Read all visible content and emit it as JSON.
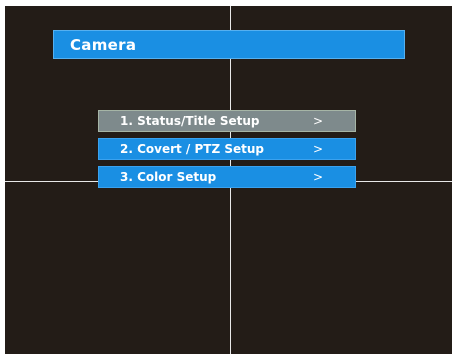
{
  "header": {
    "title": "Camera"
  },
  "menu": {
    "items": [
      {
        "label": "1. Status/Title Setup",
        "arrow": ">",
        "selected": true
      },
      {
        "label": "2. Covert / PTZ Setup",
        "arrow": ">",
        "selected": false
      },
      {
        "label": "3. Color Setup",
        "arrow": ">",
        "selected": false
      }
    ]
  },
  "colors": {
    "background": "#231c17",
    "accent": "#1a8fe3",
    "selected": "#7e8a8c",
    "crosshair": "#e8e8e8",
    "text": "#ffffff"
  }
}
